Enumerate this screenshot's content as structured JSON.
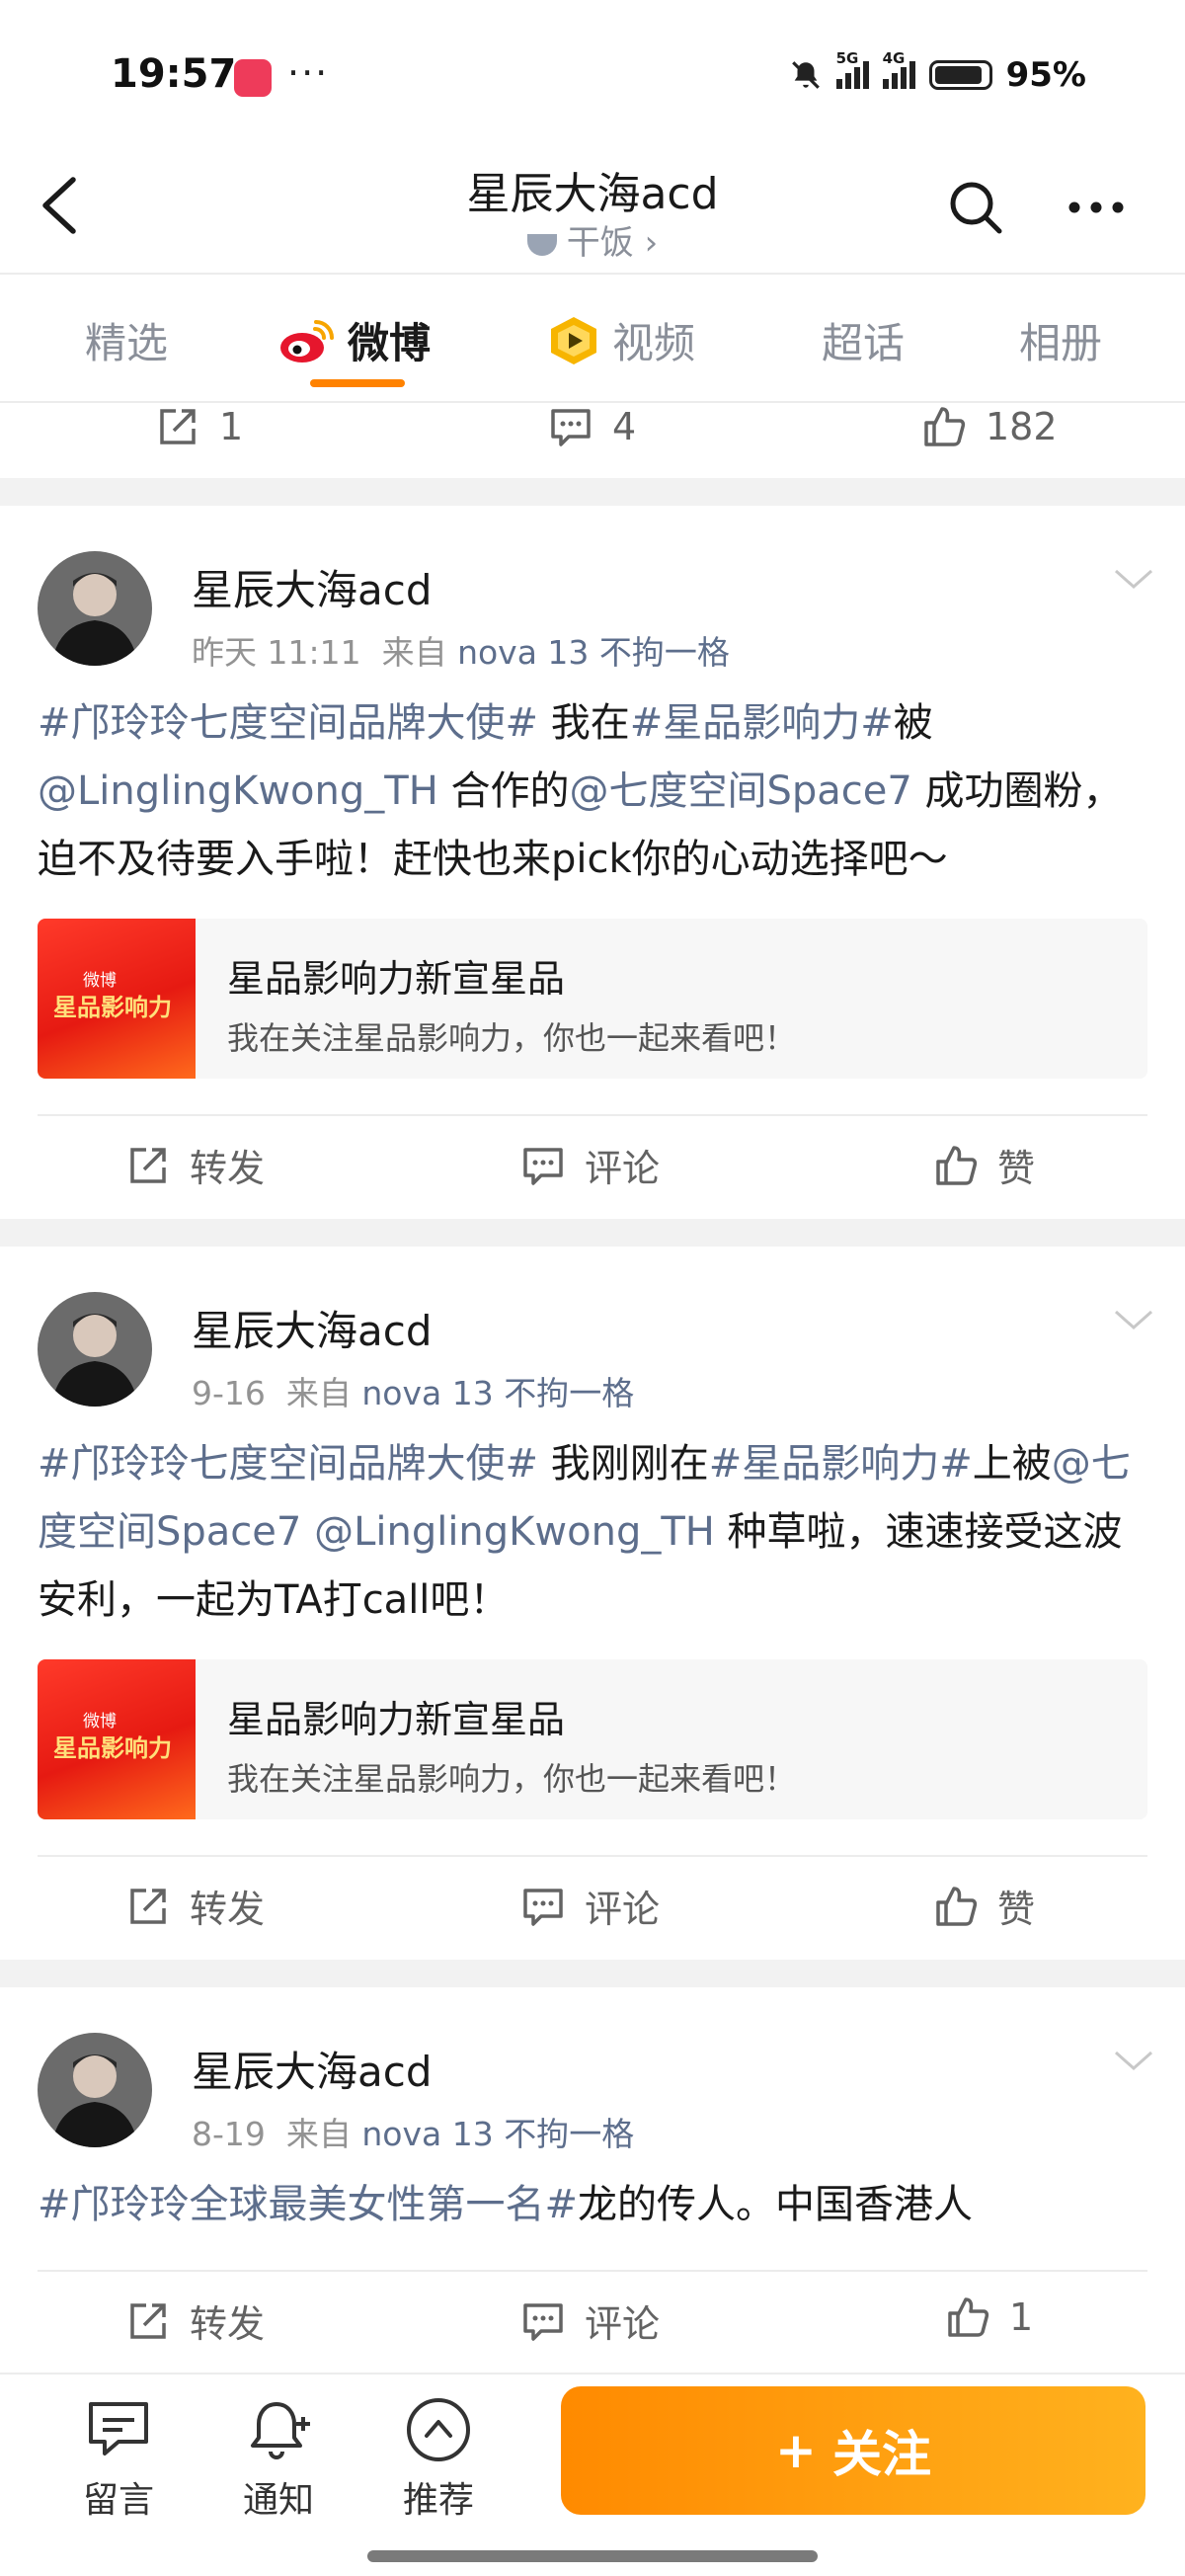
{
  "status": {
    "time": "19:57",
    "dots": "···",
    "battery": "95%",
    "signal1": "5G",
    "signal2": "4G"
  },
  "header": {
    "title": "星辰大海acd",
    "subtitle": "干饭 ›"
  },
  "tabs": [
    {
      "label": "精选"
    },
    {
      "label": "微博"
    },
    {
      "label": "视频"
    },
    {
      "label": "超话"
    },
    {
      "label": "相册"
    }
  ],
  "top_actions": {
    "repost": "1",
    "comment": "4",
    "like": "182"
  },
  "posts": [
    {
      "author": "星辰大海acd",
      "time": "昨天 11:11",
      "from": "来自",
      "source": "nova 13 不拘一格",
      "text_parts": [
        {
          "text": "#邝玲玲七度空间品牌大使#",
          "link": true
        },
        {
          "text": " 我在",
          "link": false
        },
        {
          "text": "#星品影响力#",
          "link": true
        },
        {
          "text": "被",
          "link": false
        },
        {
          "text": "@LinglingKwong_TH",
          "link": true
        },
        {
          "text": " 合作的",
          "link": false
        },
        {
          "text": "@七度空间Space7",
          "link": true
        },
        {
          "text": " 成功圈粉，迫不及待要入手啦！赶快也来pick你的心动选择吧～",
          "link": false
        }
      ],
      "card": {
        "thumb_top": "微博",
        "thumb_main": "星品影响力",
        "title": "星品影响力新宣星品",
        "desc": "我在关注星品影响力，你也一起来看吧！"
      },
      "actions": {
        "repost": "转发",
        "comment": "评论",
        "like": "赞"
      }
    },
    {
      "author": "星辰大海acd",
      "time": "9-16",
      "from": "来自",
      "source": "nova 13 不拘一格",
      "text_parts": [
        {
          "text": "#邝玲玲七度空间品牌大使#",
          "link": true
        },
        {
          "text": " 我刚刚在",
          "link": false
        },
        {
          "text": "#星品影响力#",
          "link": true
        },
        {
          "text": "上被",
          "link": false
        },
        {
          "text": "@七度空间Space7",
          "link": true
        },
        {
          "text": " ",
          "link": false
        },
        {
          "text": "@LinglingKwong_TH",
          "link": true
        },
        {
          "text": " 种草啦，速速接受这波安利，一起为TA打call吧！",
          "link": false
        }
      ],
      "card": {
        "thumb_top": "微博",
        "thumb_main": "星品影响力",
        "title": "星品影响力新宣星品",
        "desc": "我在关注星品影响力，你也一起来看吧！"
      },
      "actions": {
        "repost": "转发",
        "comment": "评论",
        "like": "赞"
      }
    },
    {
      "author": "星辰大海acd",
      "time": "8-19",
      "from": "来自",
      "source": "nova 13 不拘一格",
      "text_parts": [
        {
          "text": "#邝玲玲全球最美女性第一名#",
          "link": true
        },
        {
          "text": "龙的传人。中国香港人",
          "link": false
        }
      ],
      "actions": {
        "repost": "转发",
        "comment": "评论",
        "like": "1"
      }
    }
  ],
  "bottom_bar": {
    "message": "留言",
    "notify": "通知",
    "recommend": "推荐",
    "follow": "关注",
    "follow_plus": "+"
  },
  "colors": {
    "accent": "#ff8200",
    "link": "#5d6e8c",
    "follow_start": "#ff8a00",
    "follow_end": "#ffb21e"
  }
}
